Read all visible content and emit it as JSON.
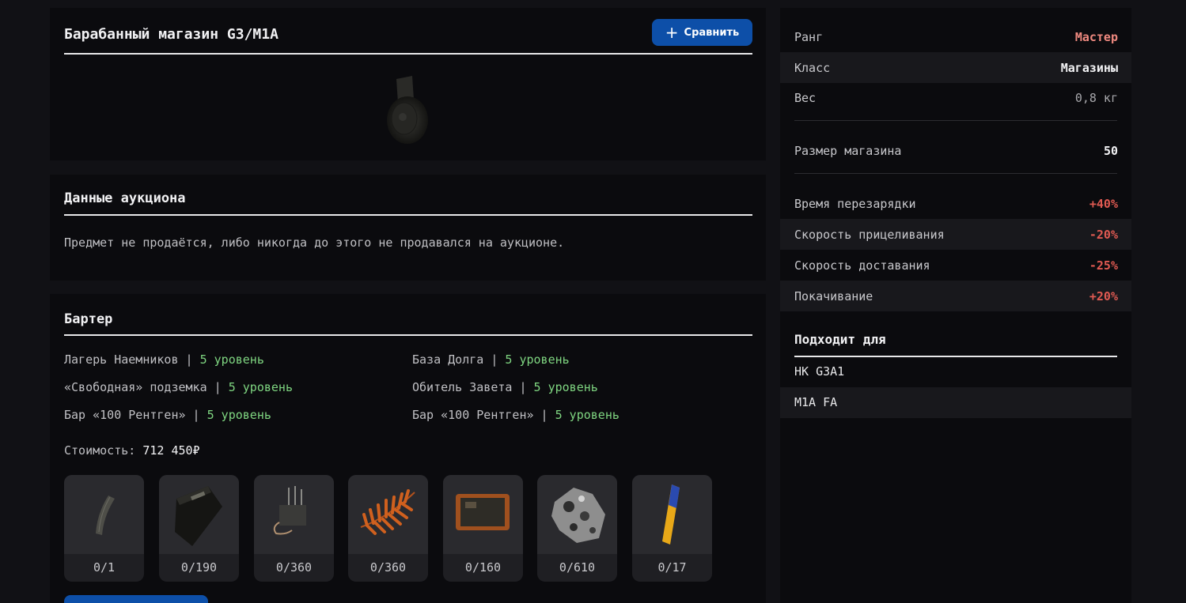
{
  "item": {
    "title": "Барабанный магазин G3/M1A",
    "compare_label": "Сравнить"
  },
  "auction": {
    "title": "Данные аукциона",
    "message": "Предмет не продаётся, либо никогда до этого не продавался на аукционе."
  },
  "barter": {
    "title": "Бартер",
    "separator": " | ",
    "locations": [
      {
        "name": "Лагерь Наемников",
        "level": "5 уровень"
      },
      {
        "name": "База Долга",
        "level": "5 уровень"
      },
      {
        "name": "«Свободная» подземка",
        "level": "5 уровень"
      },
      {
        "name": "Обитель Завета",
        "level": "5 уровень"
      },
      {
        "name": "Бар «100 Рентген»",
        "level": "5 уровень"
      },
      {
        "name": "Бар «100 Рентген»",
        "level": "5 уровень"
      }
    ],
    "cost_label": "Стоимость:",
    "cost_value": "712 450₽",
    "ingredients": [
      {
        "icon": "magazine-icon",
        "qty": "0/1"
      },
      {
        "icon": "ammo-box-icon",
        "qty": "0/190"
      },
      {
        "icon": "electronics-icon",
        "qty": "0/360"
      },
      {
        "icon": "fern-icon",
        "qty": "0/360"
      },
      {
        "icon": "tablet-icon",
        "qty": "0/160"
      },
      {
        "icon": "ore-icon",
        "qty": "0/610"
      },
      {
        "icon": "vial-icon",
        "qty": "0/17"
      }
    ]
  },
  "stats": {
    "rank": {
      "label": "Ранг",
      "value": "Мастер"
    },
    "class": {
      "label": "Класс",
      "value": "Магазины"
    },
    "weight": {
      "label": "Вес",
      "value": "0,8 кг"
    },
    "mag_size": {
      "label": "Размер магазина",
      "value": "50"
    },
    "reload": {
      "label": "Время перезарядки",
      "value": "+40%"
    },
    "ads": {
      "label": "Скорость прицеливания",
      "value": "-20%"
    },
    "draw": {
      "label": "Скорость доставания",
      "value": "-25%"
    },
    "sway": {
      "label": "Покачивание",
      "value": "+20%"
    }
  },
  "fits": {
    "title": "Подходит для",
    "items": [
      "HK G3A1",
      "M1A FA"
    ]
  },
  "colors": {
    "accent_blue": "#0d4fa8",
    "level_green": "#7fd681",
    "negative_red": "#e05a52",
    "rank_master": "#f08a80"
  }
}
